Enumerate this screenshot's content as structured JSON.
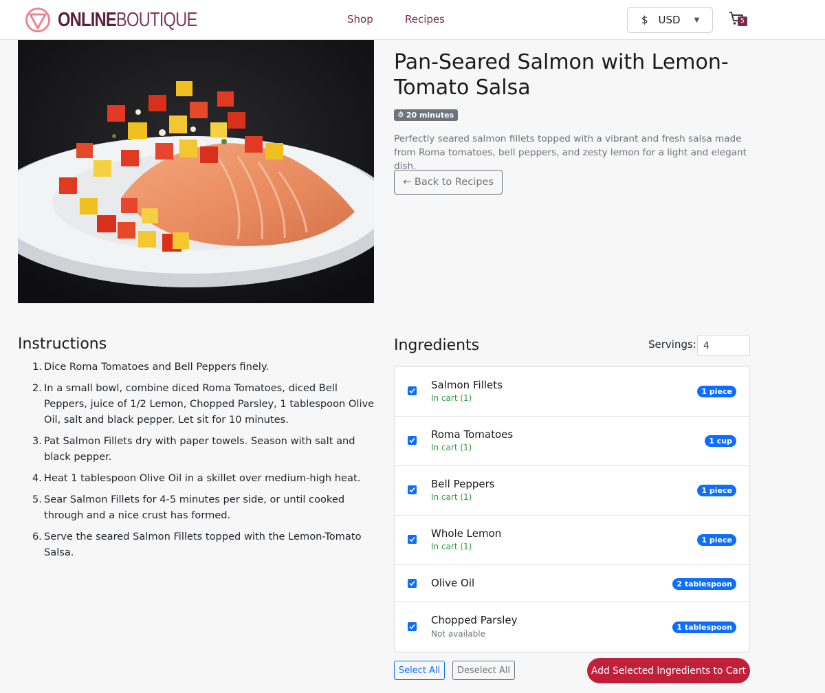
{
  "brand": {
    "name_bold": "ONLINE",
    "name_light": "BOUTIQUE",
    "color": "#5a1e3c"
  },
  "nav": {
    "shop": "Shop",
    "recipes": "Recipes"
  },
  "currency": {
    "symbol": "$",
    "code": "USD",
    "caret": "▼"
  },
  "cart": {
    "count": "5"
  },
  "recipe": {
    "title": "Pan-Seared Salmon with Lemon-Tomato Salsa",
    "time_icon": "⏱",
    "time": "20 minutes",
    "description": "Perfectly seared salmon fillets topped with a vibrant and fresh salsa made from Roma tomatoes, bell peppers, and zesty lemon for a light and elegant dish.",
    "back_label": "← Back to Recipes"
  },
  "instructions": {
    "heading": "Instructions",
    "steps": [
      {
        "num": "1.",
        "text": "Dice Roma Tomatoes and Bell Peppers finely."
      },
      {
        "num": "2.",
        "text": "In a small bowl, combine diced Roma Tomatoes, diced Bell Peppers, juice of 1/2 Lemon, Chopped Parsley, 1 tablespoon Olive Oil, salt and black pepper. Let sit for 10 minutes."
      },
      {
        "num": "3.",
        "text": "Pat Salmon Fillets dry with paper towels. Season with salt and black pepper."
      },
      {
        "num": "4.",
        "text": "Heat 1 tablespoon Olive Oil in a skillet over medium-high heat."
      },
      {
        "num": "5.",
        "text": "Sear Salmon Fillets for 4-5 minutes per side, or until cooked through and a nice crust has formed."
      },
      {
        "num": "6.",
        "text": "Serve the seared Salmon Fillets topped with the Lemon-Tomato Salsa."
      }
    ]
  },
  "ingredients": {
    "heading": "Ingredients",
    "servings_label": "Servings:",
    "servings_value": "4",
    "items": [
      {
        "name": "Salmon Fillets",
        "status": "In cart (1)",
        "qty": "1 piece",
        "checked": true
      },
      {
        "name": "Roma Tomatoes",
        "status": "In cart (1)",
        "qty": "1 cup",
        "checked": true
      },
      {
        "name": "Bell Peppers",
        "status": "In cart (1)",
        "qty": "1 piece",
        "checked": true
      },
      {
        "name": "Whole Lemon",
        "status": "In cart (1)",
        "qty": "1 piece",
        "checked": true
      },
      {
        "name": "Olive Oil",
        "status": "",
        "qty": "2 tablespoon",
        "checked": true
      },
      {
        "name": "Chopped Parsley",
        "status": "Not available",
        "qty": "1 tablespoon",
        "checked": true
      }
    ],
    "select_all": "Select All",
    "deselect_all": "Deselect All",
    "add_to_cart": "Add Selected Ingredients to Cart"
  },
  "colors": {
    "accent": "#0d6efd",
    "brand": "#7a2a4b",
    "cta": "#c0203a",
    "in_cart": "#2e9a3e"
  }
}
